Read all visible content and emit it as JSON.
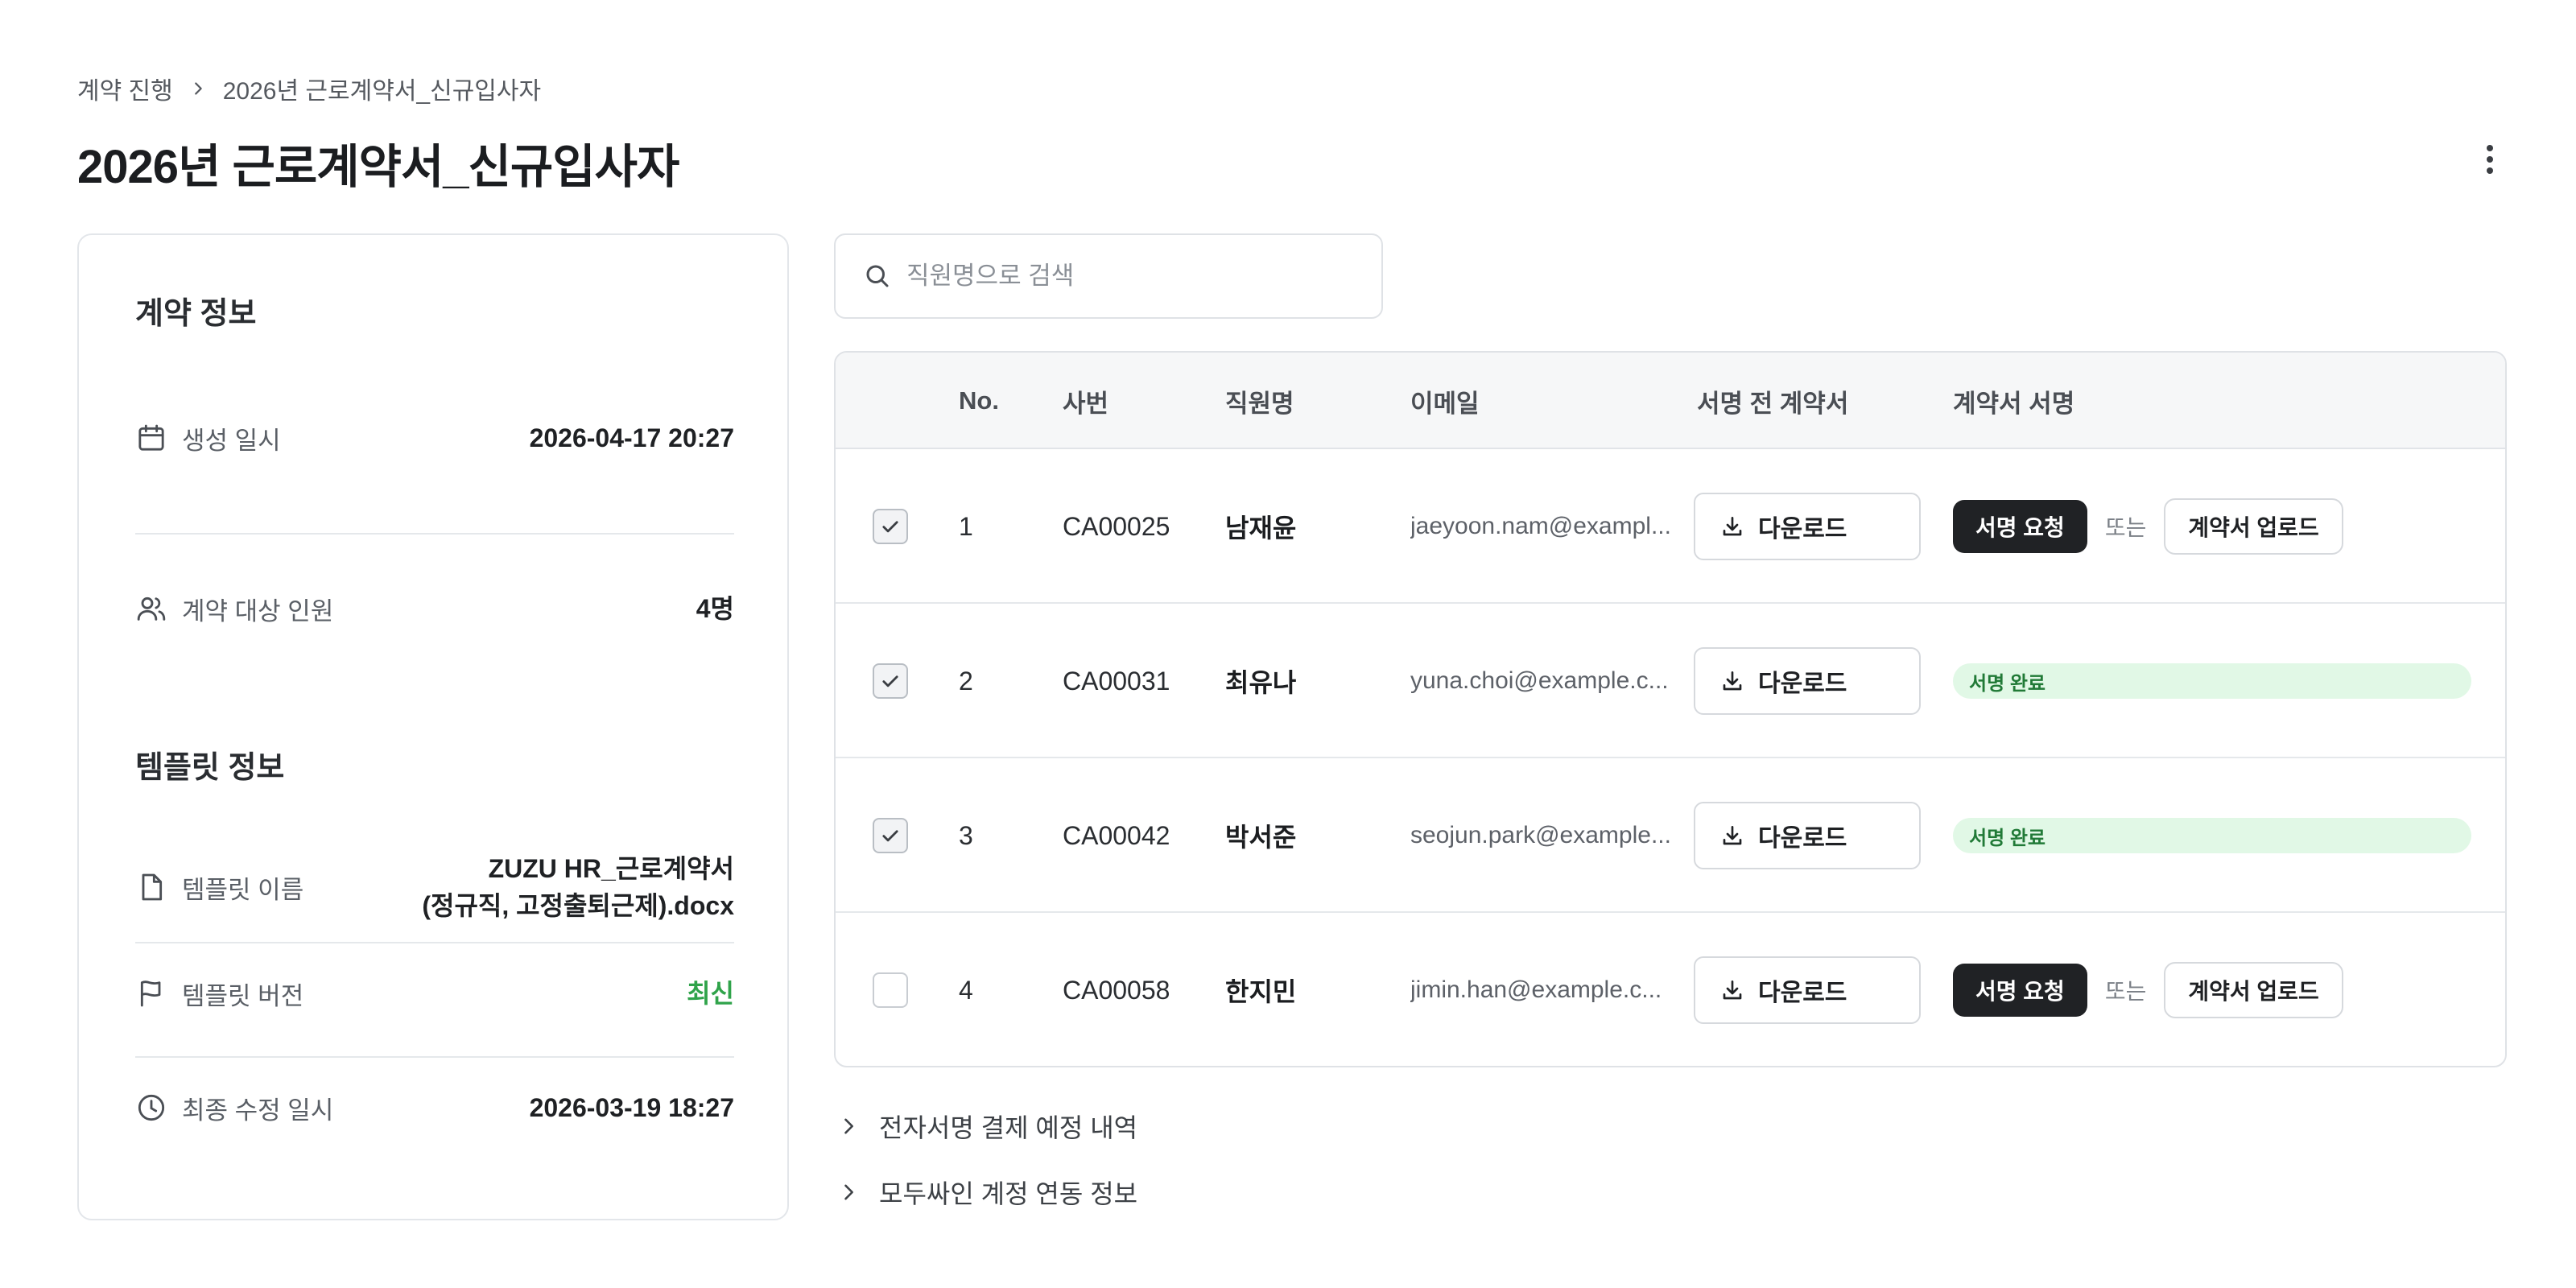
{
  "breadcrumb": {
    "parent": "계약 진행",
    "current": "2026년 근로계약서_신규입사자"
  },
  "page": {
    "title": "2026년 근로계약서_신규입사자"
  },
  "contract_info": {
    "title": "계약 정보",
    "created_label": "생성 일시",
    "created_value": "2026-04-17 20:27",
    "target_label": "계약 대상 인원",
    "target_value": "4명"
  },
  "template_info": {
    "title": "템플릿 정보",
    "name_label": "템플릿 이름",
    "name_line1": "ZUZU HR_근로계약서",
    "name_line2": "(정규직, 고정출퇴근제).docx",
    "version_label": "템플릿 버전",
    "version_value": "최신",
    "modified_label": "최종 수정 일시",
    "modified_value": "2026-03-19 18:27"
  },
  "search": {
    "placeholder": "직원명으로 검색"
  },
  "table": {
    "headers": {
      "no": "No.",
      "emp_id": "사번",
      "name": "직원명",
      "email": "이메일",
      "pre_contract": "서명 전 계약서",
      "signature": "계약서 서명"
    },
    "download_label": "다운로드",
    "sign_request_label": "서명 요청",
    "or_label": "또는",
    "upload_label": "계약서 업로드",
    "signed_label": "서명 완료",
    "rows": [
      {
        "no": "1",
        "emp_id": "CA00025",
        "name": "남재윤",
        "email": "jaeyoon.nam@exampl...",
        "checked": true,
        "status": "request"
      },
      {
        "no": "2",
        "emp_id": "CA00031",
        "name": "최유나",
        "email": "yuna.choi@example.c...",
        "checked": true,
        "status": "signed"
      },
      {
        "no": "3",
        "emp_id": "CA00042",
        "name": "박서준",
        "email": "seojun.park@example...",
        "checked": true,
        "status": "signed"
      },
      {
        "no": "4",
        "emp_id": "CA00058",
        "name": "한지민",
        "email": "jimin.han@example.c...",
        "checked": false,
        "status": "request"
      }
    ]
  },
  "accordions": {
    "payment": "전자서명 결제 예정 내역",
    "modusign": "모두싸인 계정 연동 정보"
  },
  "colors": {
    "accent_dark": "#202225",
    "success_green": "#2fa34a",
    "badge_bg": "#e1f8e6"
  }
}
